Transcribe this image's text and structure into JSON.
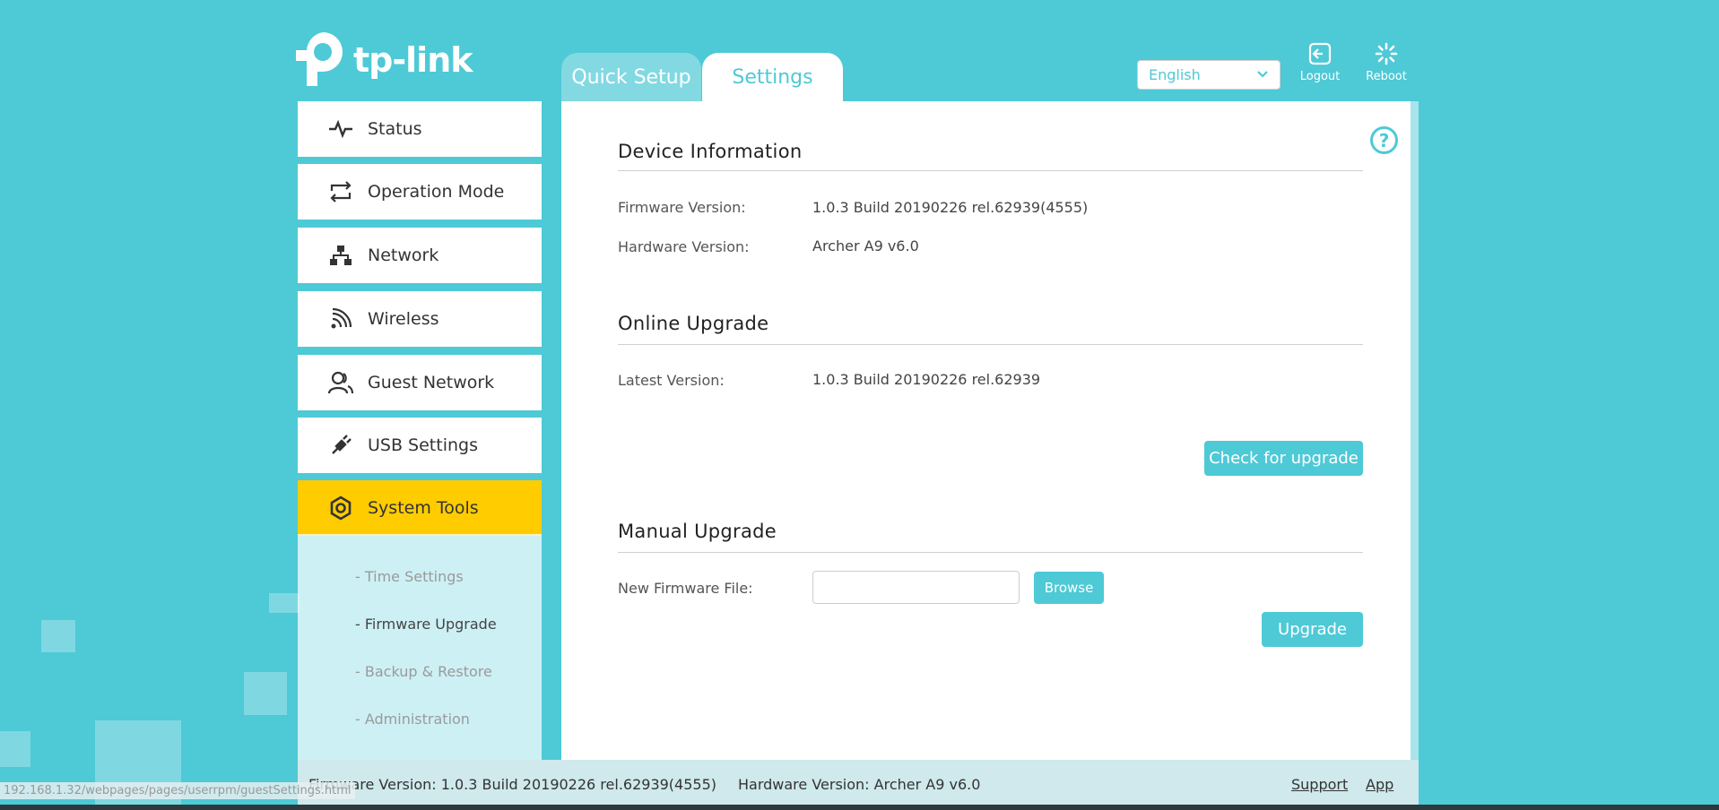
{
  "brand": {
    "logo_text": "tp-link"
  },
  "tabs": [
    {
      "label": "Quick Setup",
      "active": false
    },
    {
      "label": "Settings",
      "active": true
    }
  ],
  "top_controls": {
    "language": "English",
    "logout_label": "Logout",
    "reboot_label": "Reboot"
  },
  "sidebar": {
    "items": [
      {
        "label": "Status",
        "icon": "pulse-icon"
      },
      {
        "label": "Operation Mode",
        "icon": "swap-icon"
      },
      {
        "label": "Network",
        "icon": "network-icon"
      },
      {
        "label": "Wireless",
        "icon": "wifi-icon"
      },
      {
        "label": "Guest Network",
        "icon": "users-icon"
      },
      {
        "label": "USB Settings",
        "icon": "usb-icon"
      },
      {
        "label": "System Tools",
        "icon": "gear-icon",
        "active": true
      }
    ],
    "sub_items": [
      {
        "label": "- Time Settings"
      },
      {
        "label": "- Firmware Upgrade",
        "current": true
      },
      {
        "label": "- Backup & Restore"
      },
      {
        "label": "- Administration"
      }
    ]
  },
  "device_info": {
    "title": "Device Information",
    "firmware_label": "Firmware Version:",
    "firmware_value": "1.0.3 Build 20190226 rel.62939(4555)",
    "hardware_label": "Hardware Version:",
    "hardware_value": "Archer A9 v6.0"
  },
  "online_upgrade": {
    "title": "Online Upgrade",
    "latest_label": "Latest Version:",
    "latest_value": "1.0.3 Build 20190226 rel.62939",
    "check_button": "Check for upgrade"
  },
  "manual_upgrade": {
    "title": "Manual Upgrade",
    "file_label": "New Firmware File:",
    "file_value": "",
    "browse_button": "Browse",
    "upgrade_button": "Upgrade"
  },
  "footer": {
    "firmware": "Firmware Version: 1.0.3 Build 20190226 rel.62939(4555)",
    "hardware": "Hardware Version: Archer A9 v6.0",
    "support_link": "Support",
    "app_link": "App"
  },
  "status_url": "192.168.1.32/webpages/pages/userrpm/guestSettings.html",
  "colors": {
    "accent": "#4ec9d6",
    "active_menu": "#ffcc00",
    "panel": "#ffffff"
  }
}
